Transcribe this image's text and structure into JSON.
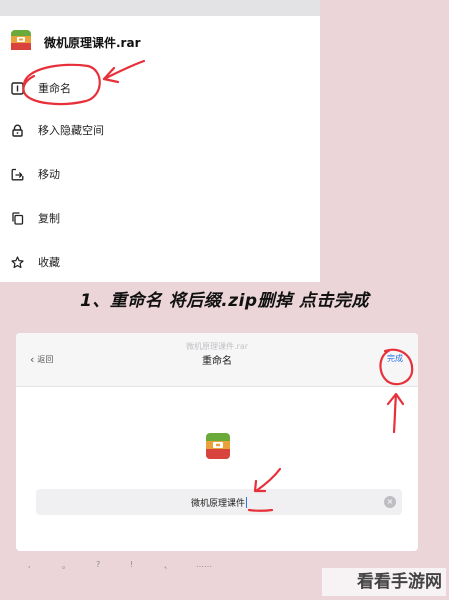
{
  "context_menu": {
    "file_name": "微机原理课件.rar",
    "items": [
      {
        "label": "重命名",
        "icon": "rename-icon"
      },
      {
        "label": "移入隐藏空间",
        "icon": "lock-icon"
      },
      {
        "label": "移动",
        "icon": "move-icon"
      },
      {
        "label": "复制",
        "icon": "copy-icon"
      },
      {
        "label": "收藏",
        "icon": "star-icon"
      }
    ]
  },
  "caption": "1、重命名 将后缀.zip删掉 点击完成",
  "rename_dialog": {
    "ghost_title": "微机原理课件.rar",
    "back_label": "返回",
    "title": "重命名",
    "done_label": "完成",
    "field_value": "微机原理课件"
  },
  "keyboard_keys": [
    ",",
    "。",
    "?",
    "!",
    "、",
    "……"
  ],
  "watermark": "看看手游网",
  "colors": {
    "annotation": "#e8303a",
    "accent": "#2f73e6",
    "page_background": "#ebd5d9"
  }
}
